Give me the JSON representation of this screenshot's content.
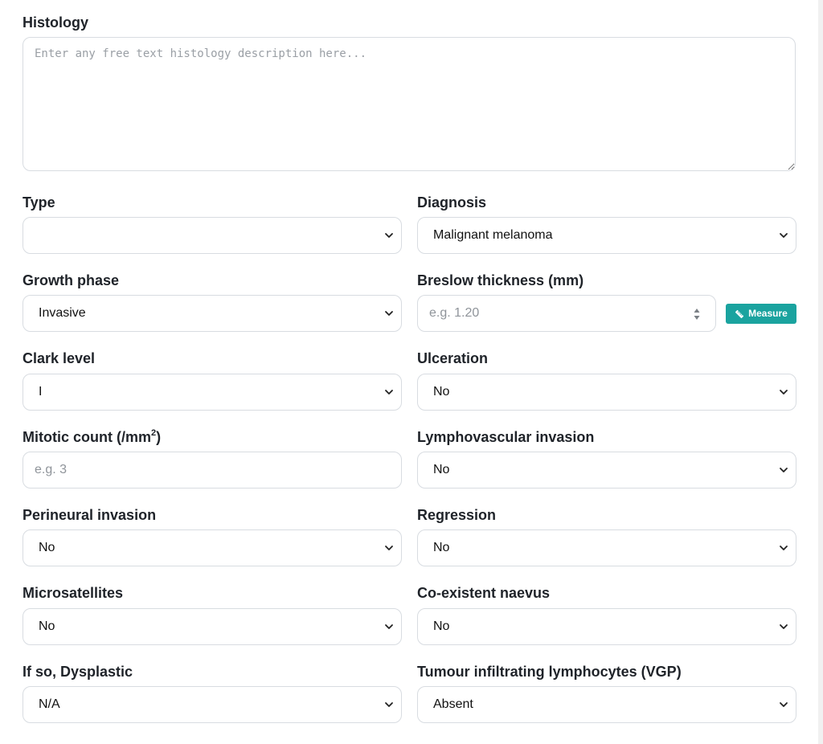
{
  "histology": {
    "label": "Histology",
    "placeholder": "Enter any free text histology description here...",
    "value": ""
  },
  "fields": {
    "type": {
      "label": "Type",
      "value": ""
    },
    "diagnosis": {
      "label": "Diagnosis",
      "value": "Malignant melanoma"
    },
    "growth_phase": {
      "label": "Growth phase",
      "value": "Invasive"
    },
    "breslow": {
      "label": "Breslow thickness (mm)",
      "placeholder": "e.g. 1.20",
      "value": ""
    },
    "measure_button": {
      "label": "Measure",
      "icon": "ruler-icon"
    },
    "clark_level": {
      "label": "Clark level",
      "value": "I"
    },
    "ulceration": {
      "label": "Ulceration",
      "value": "No"
    },
    "mitotic": {
      "label": "Mitotic count (/mm",
      "label_sup": "2",
      "label_end": ")",
      "placeholder": "e.g. 3",
      "value": ""
    },
    "lymphovascular": {
      "label": "Lymphovascular invasion",
      "value": "No"
    },
    "perineural": {
      "label": "Perineural invasion",
      "value": "No"
    },
    "regression": {
      "label": "Regression",
      "value": "No"
    },
    "microsatellites": {
      "label": "Microsatellites",
      "value": "No"
    },
    "coexistent_naevus": {
      "label": "Co-existent naevus",
      "value": "No"
    },
    "dysplastic": {
      "label": "If so, Dysplastic",
      "value": "N/A"
    },
    "til": {
      "label": "Tumour infiltrating lymphocytes (VGP)",
      "value": "Absent"
    }
  },
  "colors": {
    "accent": "#1aa39f",
    "border": "#d8dce1",
    "label": "#1f2329"
  }
}
